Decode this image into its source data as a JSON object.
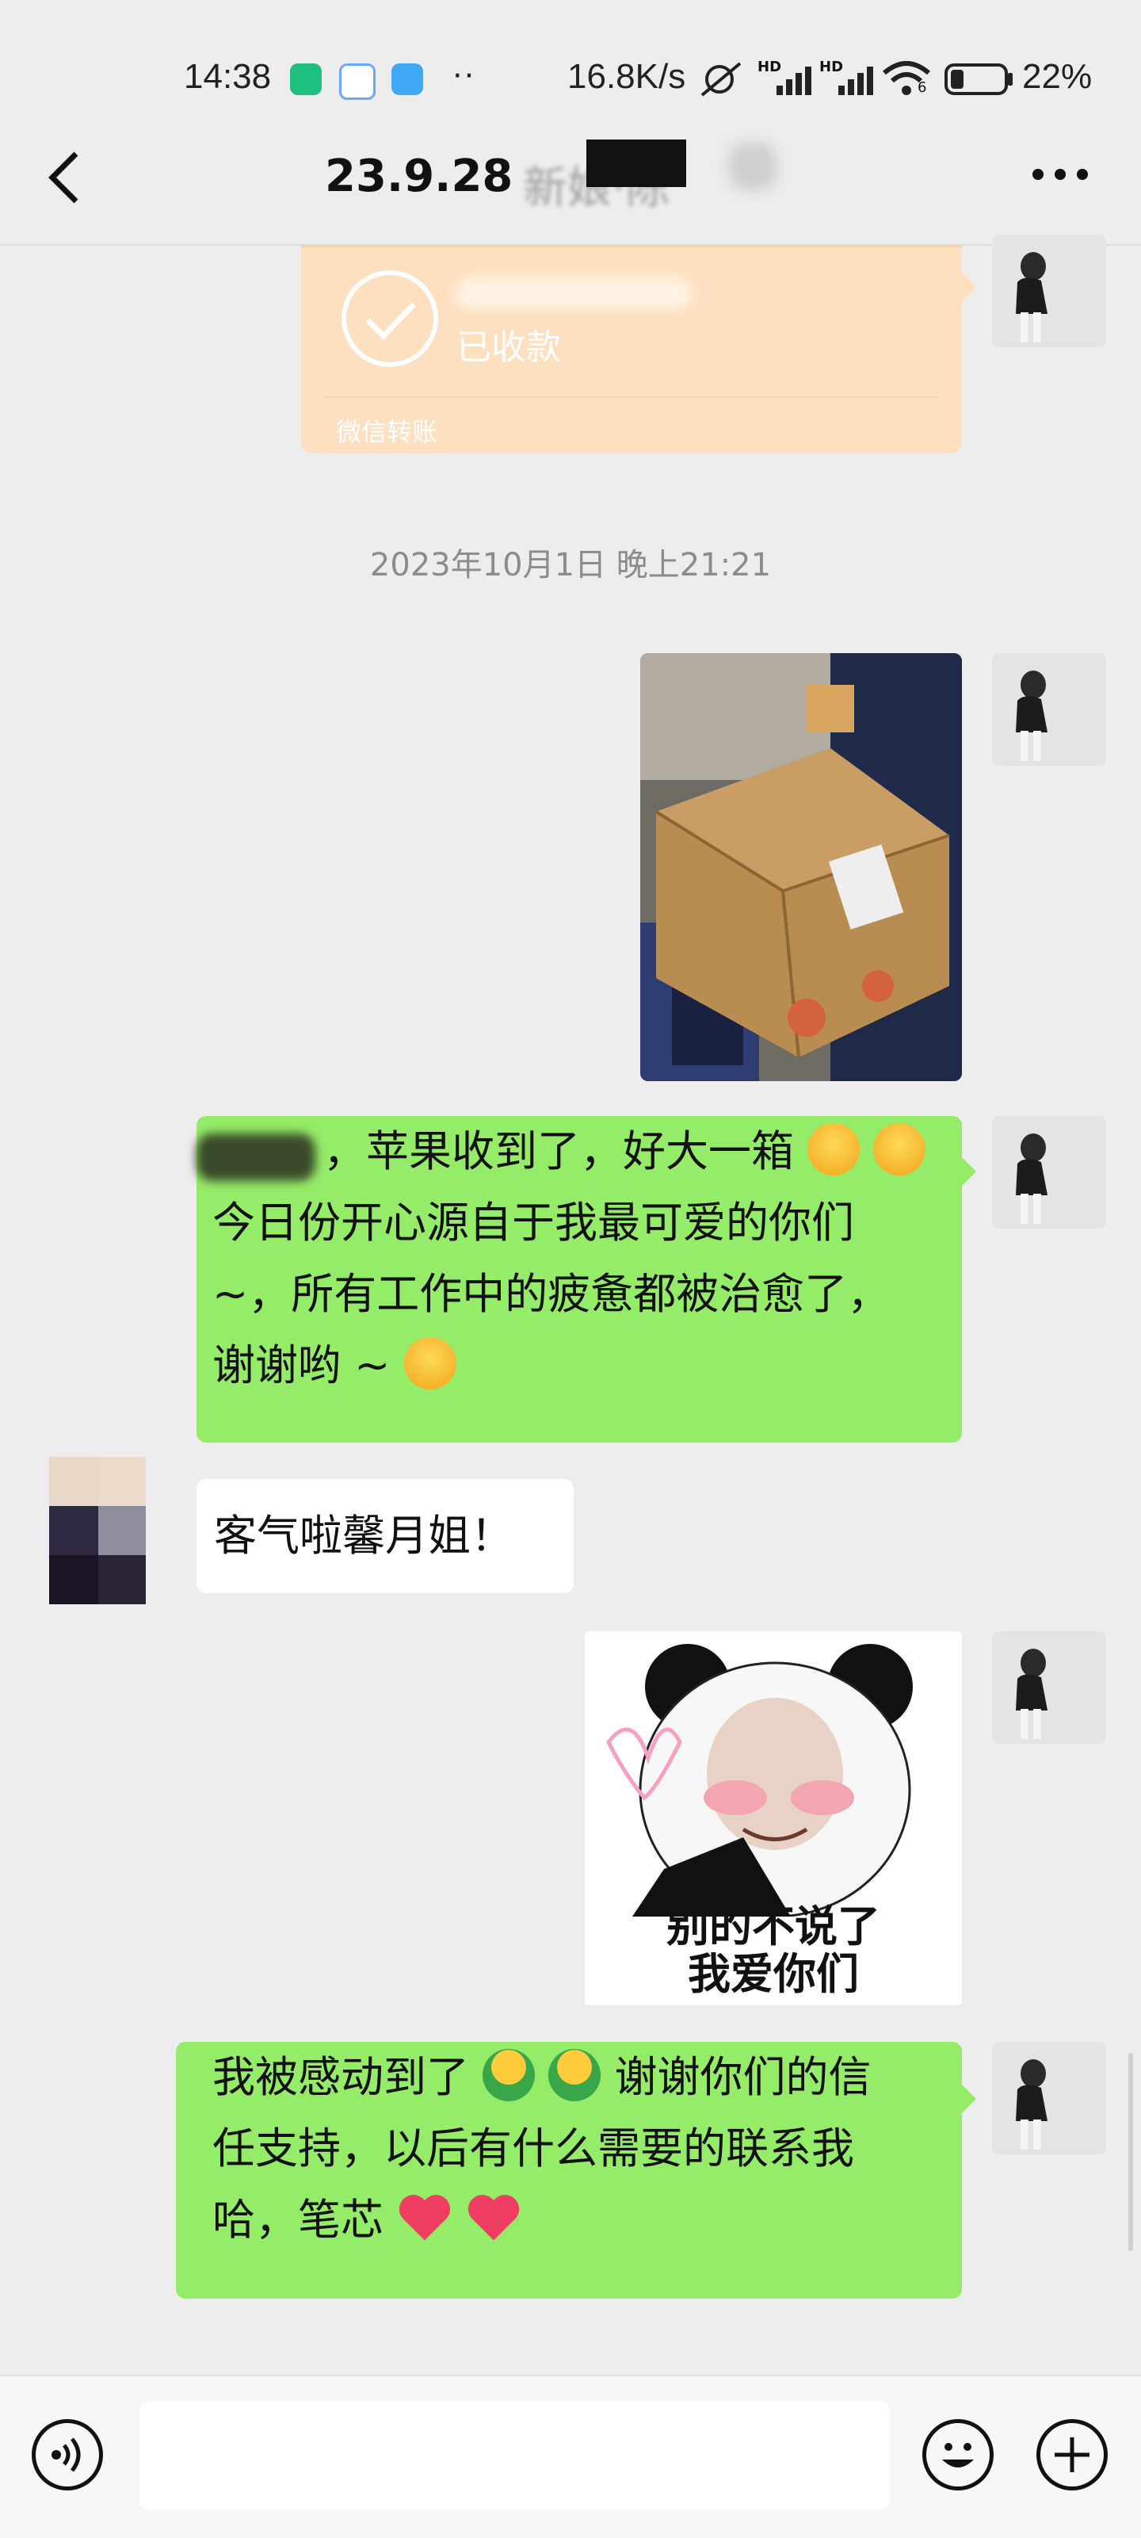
{
  "status_bar": {
    "time": "14:38",
    "more_dots": "··",
    "net_speed": "16.8K/s",
    "hd1": "HD",
    "hd2": "HD",
    "wifi_label": "6",
    "battery": "22%"
  },
  "nav": {
    "title": "23.9.28",
    "title_suffix": "新娘·陈"
  },
  "transfer": {
    "status": "已收款",
    "footer": "微信转账"
  },
  "timestamp": "2023年10月1日 晚上21:21",
  "messages": [
    {
      "side": "right",
      "lines": [
        "，苹果收到了，好大一箱",
        "今日份开心源自于我最可爱的你们",
        "~，所有工作中的疲惫都被治愈了，",
        "谢谢哟 ~"
      ]
    },
    {
      "side": "left",
      "text": "客气啦馨月姐！"
    },
    {
      "side": "right",
      "sticker_caption_1": "别的不说了",
      "sticker_caption_2": "我爱你们"
    },
    {
      "side": "right",
      "lines": [
        "我被感动到了",
        "谢谢你们的信",
        "任支持，以后有什么需要的联系我",
        "哈，笔芯"
      ]
    }
  ],
  "colors": {
    "bubble_green": "#95ec69",
    "transfer_orange": "#fde0c0",
    "background": "#ededed"
  },
  "icons": {
    "back": "back-chevron-icon",
    "more": "more-dots-icon",
    "voice": "voice-icon",
    "emoji": "emoji-icon",
    "plus": "plus-icon"
  }
}
